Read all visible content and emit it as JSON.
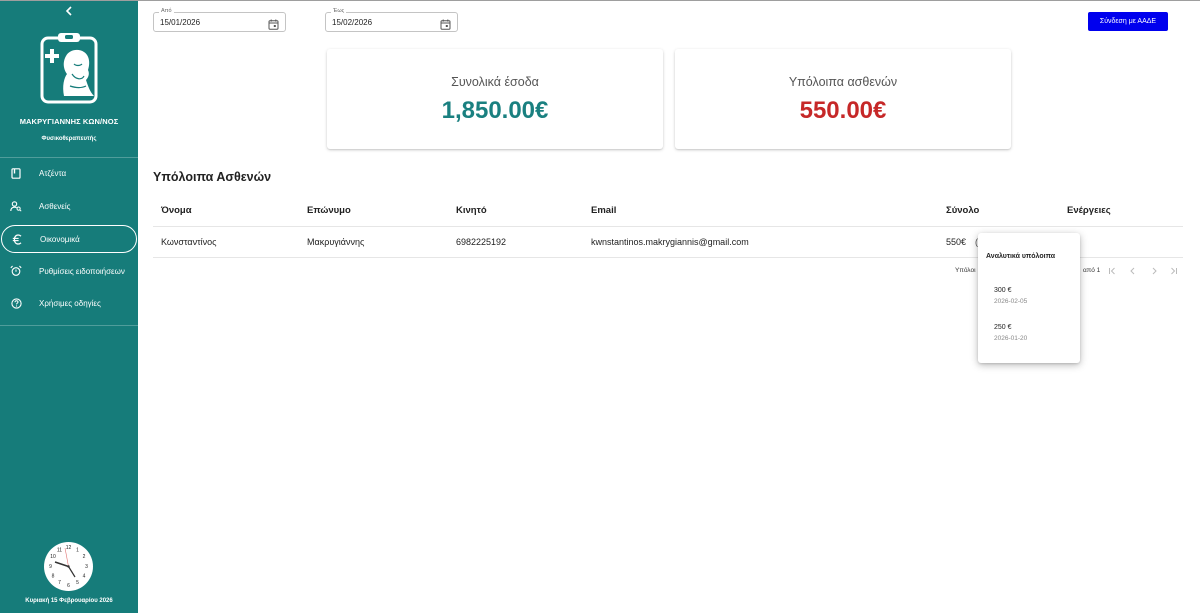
{
  "sidebar": {
    "collapse_icon": "chevron-left-icon",
    "logo_icon": "doctor-clipboard-logo",
    "doctor_name": "ΜΑΚΡΥΓΙΑΝΝΗΣ ΚΩΝ/ΝΟΣ",
    "doctor_role": "Φυσικοθεραπευτής",
    "items": [
      {
        "label": "Ατζέντα",
        "icon": "book-icon",
        "active": false
      },
      {
        "label": "Ασθενείς",
        "icon": "person-search-icon",
        "active": false
      },
      {
        "label": "Οικονομικά",
        "icon": "euro-icon",
        "active": true
      },
      {
        "label": "Ρυθμίσεις ειδοποιήσεων",
        "icon": "alarm-icon",
        "active": false
      },
      {
        "label": "Χρήσιμες οδηγίες",
        "icon": "help-icon",
        "active": false
      }
    ],
    "clock_icon": "analog-clock",
    "date_text": "Κυριακή 15 Φεβρουαρίου 2026"
  },
  "filters": {
    "from_label": "Από",
    "from_value": "15/01/2026",
    "to_label": "Έως",
    "to_value": "15/02/2026"
  },
  "aade_button": "Σύνδεση με ΑΑΔΕ",
  "cards": {
    "income_title": "Συνολικά έσοδα",
    "income_value": "1,850.00€",
    "balance_title": "Υπόλοιπα ασθενών",
    "balance_value": "550.00€"
  },
  "colors": {
    "sidebar_bg": "#167c7a",
    "income_color": "#1a8080",
    "balance_color": "#c62828",
    "aade_button_bg": "#0000ee"
  },
  "table": {
    "title": "Υπόλοιπα Ασθενών",
    "headers": {
      "name": "Όνομα",
      "surname": "Επώνυμο",
      "mobile": "Κινητό",
      "email": "Email",
      "total": "Σύνολο",
      "actions": "Ενέργειες"
    },
    "rows": [
      {
        "name": "Κωνσταντίνος",
        "surname": "Μακρυγιάννης",
        "mobile": "6982225192",
        "email": "kwnstantinos.makrygiannis@gmail.com",
        "total": "550€",
        "action_glyph": "("
      }
    ],
    "pagination": {
      "label_partial": "Υπόλοι",
      "range_partial": "από 1"
    }
  },
  "popover": {
    "title": "Αναλυτικά υπόλοιπα",
    "items": [
      {
        "amount": "300 €",
        "date": "2026-02-05"
      },
      {
        "amount": "250 €",
        "date": "2026-01-20"
      }
    ]
  }
}
